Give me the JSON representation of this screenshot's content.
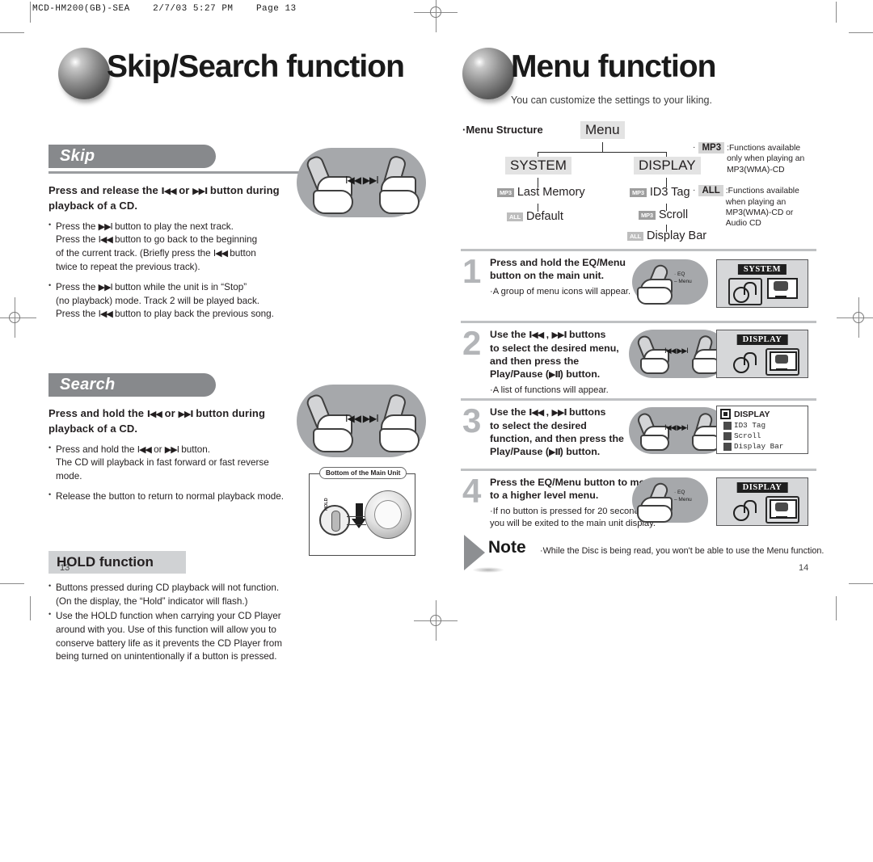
{
  "print_slug": "MCD-HM200(GB)-SEA    2/7/03 5:27 PM    Page 13",
  "left_page": {
    "page_number": "13",
    "chapter_title": "Skip/Search function",
    "sections": [
      {
        "heading": "Skip",
        "lead": "Press and release the  I◀◀  or  ▶▶I  button during playback of a CD.",
        "lead_parts": [
          "Press and release the",
          "I◀◀",
          "or",
          "▶▶I",
          "button during playback of a CD."
        ],
        "bullets": [
          "Press the ▶▶I button to play the next track.\nPress the I◀◀ button to go back to the beginning of the current track. (Briefly press the I◀◀ button twice to repeat the previous track).",
          "Press the ▶▶I button while the unit is in “Stop” (no playback) mode. Track 2 will be played back.\nPress the I◀◀ button to play back the previous song."
        ],
        "illustration_label": "I◀◀  ▶▶I"
      },
      {
        "heading": "Search",
        "lead_parts": [
          "Press and hold the",
          "I◀◀",
          "or",
          "▶▶I",
          "button during playback of a CD."
        ],
        "bullets": [
          "Press and hold the I◀◀ or ▶▶I button.\nThe CD will playback in fast forward or fast reverse mode.",
          "Release the button to return to normal playback mode."
        ],
        "illustration_label": "I◀◀  ▶▶I"
      }
    ],
    "hold": {
      "heading": "HOLD function",
      "bullets": [
        "Buttons pressed during CD playback will not function. (On the display, the “Hold” indicator will flash.)",
        "Use the HOLD function when carrying your CD Player around with you. Use of this function will allow you to conserve battery life as it prevents the CD Player from being turned on unintentionally if a button is pressed."
      ],
      "figure_caption": "Bottom of the Main Unit",
      "switch_label": "HOLD"
    }
  },
  "right_page": {
    "page_number": "14",
    "chapter_title": "Menu function",
    "chapter_subtitle": "You can customize the settings to your liking.",
    "menu_structure": {
      "label": "Menu Structure",
      "root": "Menu",
      "branches": [
        {
          "name": "SYSTEM",
          "items": [
            {
              "tag": "MP3",
              "label": "Last Memory"
            },
            {
              "tag": "ALL",
              "label": "Default"
            }
          ]
        },
        {
          "name": "DISPLAY",
          "items": [
            {
              "tag": "MP3",
              "label": "ID3 Tag"
            },
            {
              "tag": "MP3",
              "label": "Scroll"
            },
            {
              "tag": "ALL",
              "label": "Display Bar"
            }
          ]
        }
      ],
      "legend": [
        {
          "chip": "MP3",
          "text": ":Functions available\nonly when playing an\nMP3(WMA)-CD"
        },
        {
          "chip": "ALL",
          "text": ":Functions available\nwhen playing an\nMP3(WMA)-CD or\nAudio CD"
        }
      ]
    },
    "steps": [
      {
        "number": "1",
        "title": "Press and hold the EQ/Menu button on the main unit.",
        "sub": "A group of menu icons will appear.",
        "button_label_top": "EQ",
        "button_label_bottom": "Menu",
        "lcd_caption": "SYSTEM"
      },
      {
        "number": "2",
        "title": "Use the I◀◀ , ▶▶I buttons to select the desired menu, and then press the Play/Pause (▶II) button.",
        "sub": "A list of functions will appear.",
        "illustration_label": "I◀◀  ▶▶I",
        "lcd_caption": "DISPLAY"
      },
      {
        "number": "3",
        "title": "Use the I◀◀ , ▶▶I buttons to select the desired function, and then press the Play/Pause (▶II) button.",
        "sub": "",
        "illustration_label": "I◀◀  ▶▶I",
        "lcd_list_title": "DISPLAY",
        "lcd_list_items": [
          "ID3 Tag",
          "Scroll",
          "Display Bar"
        ]
      },
      {
        "number": "4",
        "title": "Press the EQ/Menu button to move to a higher level menu.",
        "sub": "If no button is pressed for 20 seconds, you will be exited to the main unit display.",
        "button_label_top": "EQ",
        "button_label_bottom": "Menu",
        "lcd_caption": "DISPLAY"
      }
    ],
    "note": {
      "word": "Note",
      "text": "While the Disc is being read, you won't be able to use the Menu function."
    }
  },
  "colors": {
    "pill_gray": "#87898c",
    "rule_gray": "#9a9c9f",
    "hand_bg": "#a6a8ab",
    "lcd_bg": "#d6d7d9",
    "tag_gray": "#9e9e9e"
  }
}
